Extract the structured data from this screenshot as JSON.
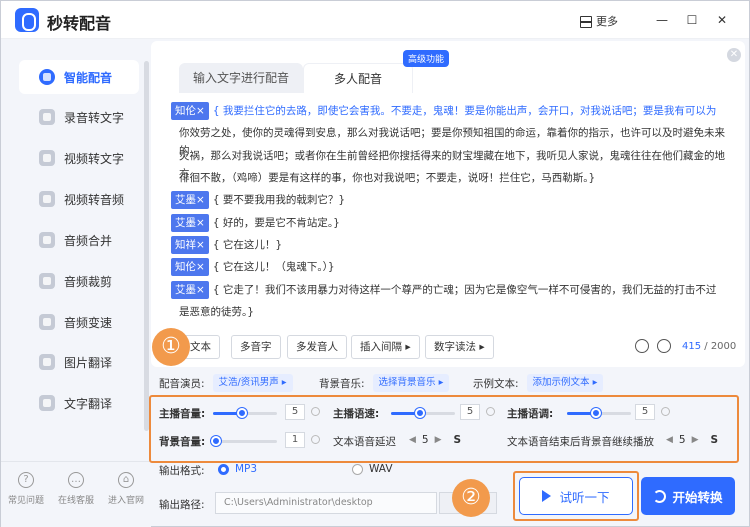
{
  "app": {
    "title": "秒转配音",
    "more": "更多"
  },
  "sidebar": {
    "items": [
      {
        "label": "智能配音",
        "icon": "smart-dub-icon",
        "active": true
      },
      {
        "label": "录音转文字",
        "icon": "record-to-text-icon"
      },
      {
        "label": "视频转文字",
        "icon": "video-to-text-icon"
      },
      {
        "label": "视频转音频",
        "icon": "video-to-audio-icon"
      },
      {
        "label": "音频合并",
        "icon": "audio-merge-icon"
      },
      {
        "label": "音频裁剪",
        "icon": "audio-cut-icon"
      },
      {
        "label": "音频变速",
        "icon": "audio-speed-icon"
      },
      {
        "label": "图片翻译",
        "icon": "image-translate-icon"
      },
      {
        "label": "文字翻译",
        "icon": "text-translate-icon"
      }
    ],
    "bottom": [
      {
        "label": "常见问题",
        "icon": "help-icon"
      },
      {
        "label": "在线客服",
        "icon": "chat-icon"
      },
      {
        "label": "进入官网",
        "icon": "website-icon"
      }
    ]
  },
  "tabs": [
    {
      "label": "输入文字进行配音"
    },
    {
      "label": "多人配音"
    }
  ],
  "premium_badge": "高级功能",
  "script_lines": [
    {
      "speaker": "知伦×",
      "text": "{ 我要拦住它的去路，即使它会害我。不要走，鬼魂！要是你能出声，会开口，对我说话吧；要是我有可以为"
    },
    {
      "speaker": "",
      "text": "你效劳之处，使你的灵魂得到安息，那么对我说话吧；要是你预知祖国的命运，靠着你的指示，也许可以及时避免未来的"
    },
    {
      "speaker": "",
      "text": "灾祸，那么对我说话吧；或者你在生前曾经把你搜括得来的财宝埋藏在地下，我听见人家说，鬼魂往往在他们藏金的地方"
    },
    {
      "speaker": "",
      "text": "徘徊不散，（鸡啼）要是有这样的事，你也对我说吧；不要走，说呀！拦住它，马西勒斯。}"
    },
    {
      "speaker": "艾墨×",
      "text": "{ 要不要我用我的戟刺它？}"
    },
    {
      "speaker": "艾墨×",
      "text": "{ 好的，要是它不肯站定。}"
    },
    {
      "speaker": "知祥×",
      "text": "{ 它在这儿！}"
    },
    {
      "speaker": "知伦×",
      "text": "{ 它在这儿！（鬼魂下。）}"
    },
    {
      "speaker": "艾墨×",
      "text": "{ 它走了！我们不该用暴力对待这样一个尊严的亡魂；因为它是像空气一样不可侵害的，我们无益的打击不过"
    },
    {
      "speaker": "",
      "text": "是恶意的徒劳。}"
    }
  ],
  "tools": {
    "text": "文本",
    "polyphone": "多音字",
    "multi_speaker": "多发音人",
    "insert_pause": "插入间隔 ▸",
    "digit_reading": "数字读法 ▸",
    "count_current": "415",
    "count_total": " / 2000"
  },
  "settings": {
    "voice_label": "配音演员:",
    "voice_value": "艾浩/资讯男声 ▸",
    "bgm_label": "背景音乐:",
    "bgm_value": "选择背景音乐 ▸",
    "sample_label": "示例文本:",
    "sample_value": "添加示例文本 ▸"
  },
  "sliders": {
    "main_volume": {
      "label": "主播音量:",
      "value": "5",
      "level": 0.45
    },
    "main_speed": {
      "label": "主播语速:",
      "value": "5",
      "level": 0.45
    },
    "main_pitch": {
      "label": "主播语调:",
      "value": "5",
      "level": 0.45
    },
    "bg_volume": {
      "label": "背景音量:",
      "value": "1",
      "level": 0.05
    }
  },
  "delays": {
    "text_delay_label": "文本语音延迟",
    "text_delay_value": "5",
    "text_delay_unit": "S",
    "bg_continue_label": "文本语音结束后背景音继续播放",
    "bg_continue_value": "5",
    "bg_continue_unit": "S"
  },
  "output": {
    "format_label": "输出格式:",
    "format_mp3": "MP3",
    "format_wav": "WAV",
    "path_label": "输出路径:",
    "path_value": "C:\\Users\\Administrator\\desktop"
  },
  "buttons": {
    "try": "试听一下",
    "start": "开始转换"
  },
  "callouts": {
    "one": "①",
    "two": "②"
  },
  "colors": {
    "accent": "#2f6bff",
    "highlight": "#ed8a3c"
  }
}
